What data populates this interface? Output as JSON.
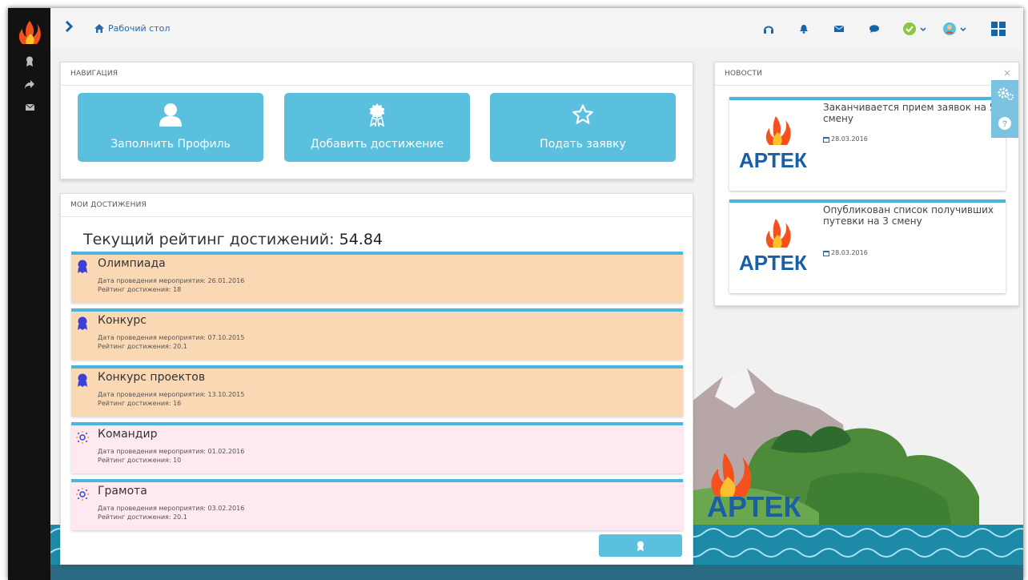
{
  "topbar": {
    "breadcrumb": "Рабочий стол",
    "icons": [
      "headset-icon",
      "bell-icon",
      "envelope-icon",
      "chat-icon",
      "status-online-icon",
      "avatar-icon",
      "apps-grid-icon"
    ]
  },
  "sidebar": {
    "items": [
      "logo-flame-icon",
      "award-icon",
      "share-icon",
      "envelope-icon"
    ]
  },
  "nav": {
    "title": "НАВИГАЦИЯ",
    "buttons": [
      {
        "label": "Заполнить Профиль",
        "icon": "user-icon"
      },
      {
        "label": "Добавить достижение",
        "icon": "award-icon"
      },
      {
        "label": "Подать заявку",
        "icon": "star-icon"
      }
    ]
  },
  "achievements": {
    "title": "МОИ ДОСТИЖЕНИЯ",
    "rating_label": "Текущий рейтинг достижений:",
    "rating_value": "54.84",
    "items": [
      {
        "title": "Олимпиада",
        "date": "Дата проведения мероприятия: 26.01.2016",
        "rating": "Рейтинг достижения: 18",
        "color": "#fbd8b4",
        "icon": "medal-icon"
      },
      {
        "title": "Конкурс",
        "date": "Дата проведения мероприятия: 07.10.2015",
        "rating": "Рейтинг достижения: 20.1",
        "color": "#fbd8b4",
        "icon": "medal-icon"
      },
      {
        "title": "Конкурс проектов",
        "date": "Дата проведения мероприятия: 13.10.2015",
        "rating": "Рейтинг достижения: 16",
        "color": "#fbd8b4",
        "icon": "medal-icon"
      },
      {
        "title": "Командир",
        "date": "Дата проведения мероприятия: 01.02.2016",
        "rating": "Рейтинг достижения: 10",
        "color": "#fde9ef",
        "icon": "sun-icon"
      },
      {
        "title": "Грамота",
        "date": "Дата проведения мероприятия: 03.02.2016",
        "rating": "Рейтинг достижения: 20.1",
        "color": "#fde9ef",
        "icon": "sun-icon"
      }
    ]
  },
  "news": {
    "title": "НОВОСТИ",
    "close": "×",
    "logo_text": "АРТЕК",
    "items": [
      {
        "title": "Заканчивается прием заявок на 5 смену",
        "date": "28.03.2016"
      },
      {
        "title": "Опубликован список получивших путевки на 3 смену",
        "date": "28.03.2016"
      }
    ]
  },
  "background": {
    "logo_text": "АРТЕК"
  },
  "colors": {
    "accent": "#5bc0de",
    "link": "#2b6aa6",
    "achievement_orange": "#fbd8b4",
    "achievement_pink": "#fde9ef",
    "brand": "#1a5fa6"
  }
}
